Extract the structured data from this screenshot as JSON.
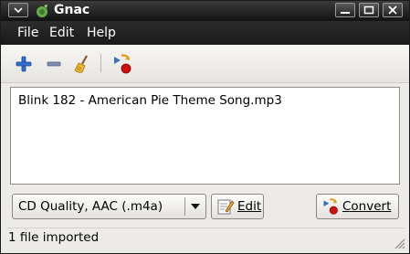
{
  "window": {
    "title": "Gnac"
  },
  "menu": [
    {
      "label": "File"
    },
    {
      "label": "Edit"
    },
    {
      "label": "Help"
    }
  ],
  "toolbar": {
    "icons": [
      "add-icon",
      "remove-icon",
      "clear-broom-icon",
      "convert-icon"
    ]
  },
  "files": [
    {
      "name": "Blink 182 - American Pie Theme Song.mp3"
    }
  ],
  "profile": {
    "selected": "CD Quality, AAC (.m4a)"
  },
  "buttons": {
    "edit_label": "Edit",
    "convert_label": "Convert"
  },
  "status": {
    "text": "1 file imported"
  },
  "colors": {
    "titlebar": "#1e1e1e",
    "menubar": "#222222",
    "add_blue": "#2f6fd0",
    "stop_red": "#d01010"
  }
}
